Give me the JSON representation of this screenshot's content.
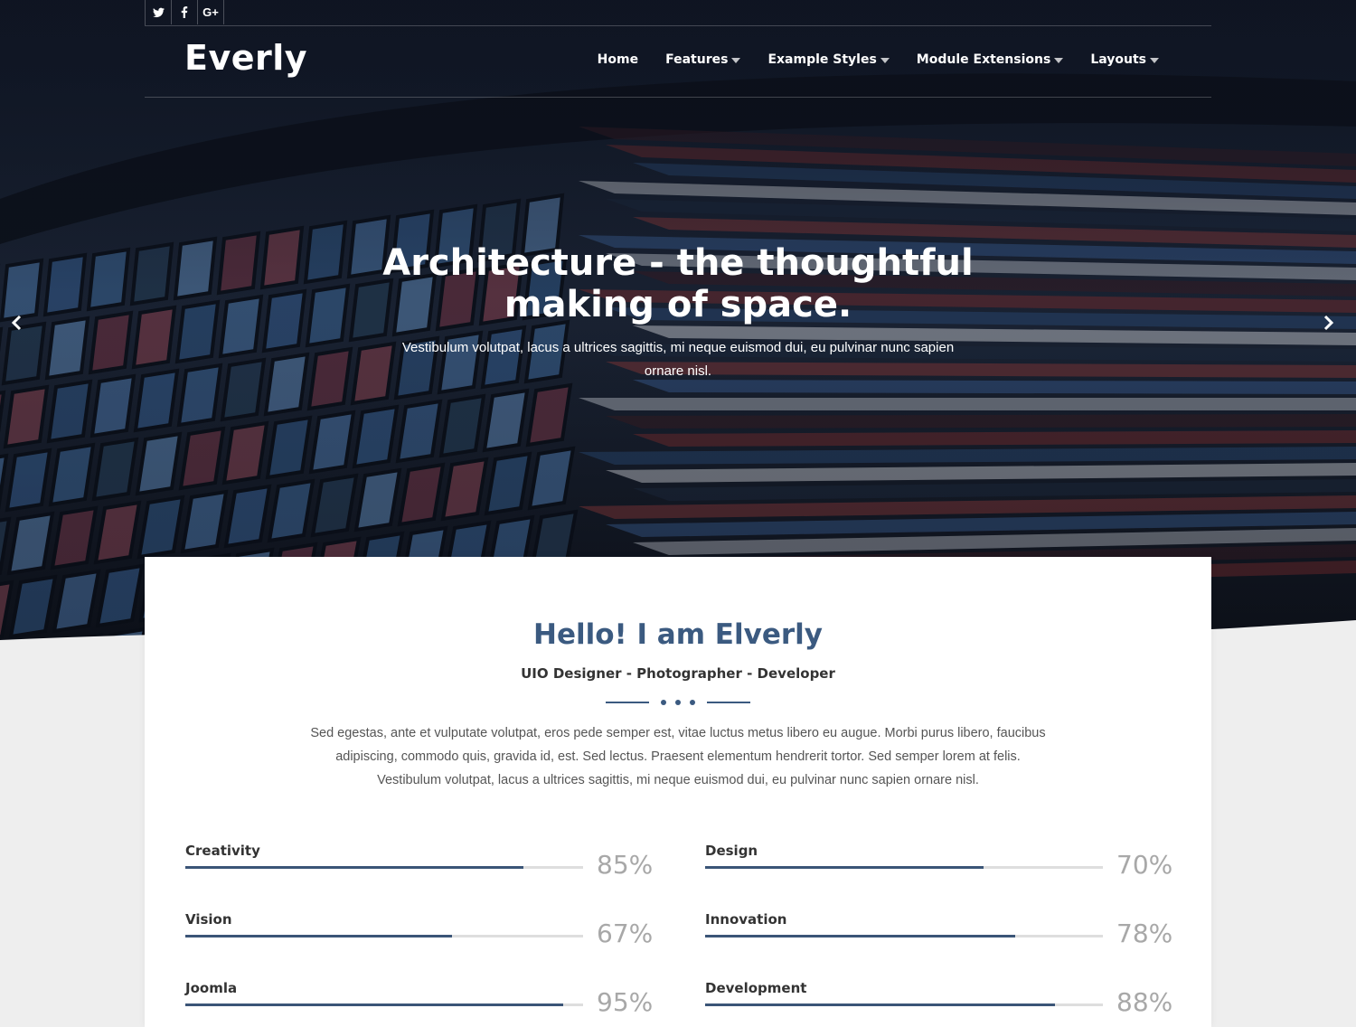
{
  "social": [
    {
      "name": "twitter-icon",
      "glyph": "🐦"
    },
    {
      "name": "facebook-icon",
      "glyph": "f"
    },
    {
      "name": "google-plus-icon",
      "glyph": "G+"
    }
  ],
  "brand": {
    "logo": "Everly"
  },
  "nav": {
    "items": [
      {
        "label": "Home",
        "dropdown": false
      },
      {
        "label": "Features",
        "dropdown": true
      },
      {
        "label": "Example Styles",
        "dropdown": true
      },
      {
        "label": "Module Extensions",
        "dropdown": true
      },
      {
        "label": "Layouts",
        "dropdown": true
      }
    ]
  },
  "hero": {
    "title_line1": "Architecture - the thoughtful",
    "title_line2": "making of space.",
    "subtitle": "Vestibulum volutpat, lacus a ultrices sagittis, mi neque euismod dui, eu pulvinar nunc sapien ornare nisl.",
    "prev_icon": "chevron-left-icon",
    "next_icon": "chevron-right-icon"
  },
  "about": {
    "title": "Hello! I am Elverly",
    "subtitle": "UIO Designer - Photographer - Developer",
    "text_line1": "Sed egestas, ante et vulputate volutpat, eros pede semper est, vitae luctus metus libero eu augue. Morbi purus libero, faucibus",
    "text_line2": "adipiscing, commodo quis, gravida id, est. Sed lectus. Praesent elementum hendrerit tortor. Sed semper lorem at felis.",
    "text_line3": "Vestibulum volutpat, lacus a ultrices sagittis, mi neque euismod dui, eu pulvinar nunc sapien ornare nisl."
  },
  "skills": [
    {
      "label": "Creativity",
      "percent": 85,
      "percent_label": "85%"
    },
    {
      "label": "Design",
      "percent": 70,
      "percent_label": "70%"
    },
    {
      "label": "Vision",
      "percent": 67,
      "percent_label": "67%"
    },
    {
      "label": "Innovation",
      "percent": 78,
      "percent_label": "78%"
    },
    {
      "label": "Joomla",
      "percent": 95,
      "percent_label": "95%"
    },
    {
      "label": "Development",
      "percent": 88,
      "percent_label": "88%"
    }
  ],
  "colors": {
    "accent": "#3b5a80",
    "bar": "#3b5577",
    "track": "#dedede",
    "page_bg": "#eeeeee"
  }
}
